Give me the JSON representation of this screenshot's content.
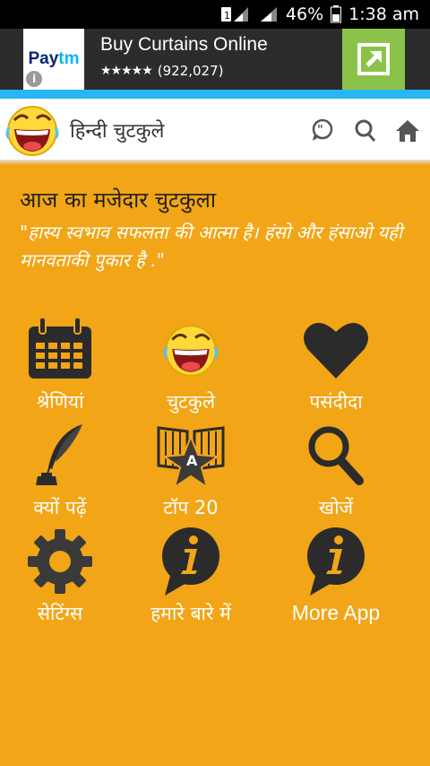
{
  "status_bar": {
    "battery": "46%",
    "time": "1:38 am"
  },
  "ad": {
    "brand_logo": "Paytm",
    "title": "Buy Curtains Online",
    "rating_count": "(922,027)",
    "open_icon": "external-link-icon"
  },
  "app_bar": {
    "title": "हिन्दी चुटकुले",
    "icons": [
      "speech-bubble-icon",
      "search-icon",
      "home-icon"
    ]
  },
  "joke_of_day": {
    "heading": "आज का मजेदार चुटकुला",
    "text": "\"हास्य स्वभाव सफलता की आत्मा है। हंसो और हंसाओ यही मानवताकी पुकार है .\""
  },
  "menu": [
    {
      "label": "श्रेणियां",
      "icon": "calendar-icon"
    },
    {
      "label": "चुटकुले",
      "icon": "laughing-face-icon"
    },
    {
      "label": "पसंदीदा",
      "icon": "heart-icon"
    },
    {
      "label": "क्यों पढ़ें",
      "icon": "quill-inkpot-icon"
    },
    {
      "label": "टॉप 20",
      "icon": "star-book-icon"
    },
    {
      "label": "खोजें",
      "icon": "magnifier-icon"
    },
    {
      "label": "सेटिंग्स",
      "icon": "gear-icon"
    },
    {
      "label": "हमारे बारे में",
      "icon": "info-bubble-icon"
    },
    {
      "label": "More App",
      "icon": "info-bubble-icon"
    }
  ],
  "colors": {
    "background": "#F2A516",
    "ad_bar": "#2c2c2c",
    "accent_line": "#29B6F6",
    "ad_open_button": "#8BC34A",
    "icon_dark": "#2b2b2b"
  }
}
